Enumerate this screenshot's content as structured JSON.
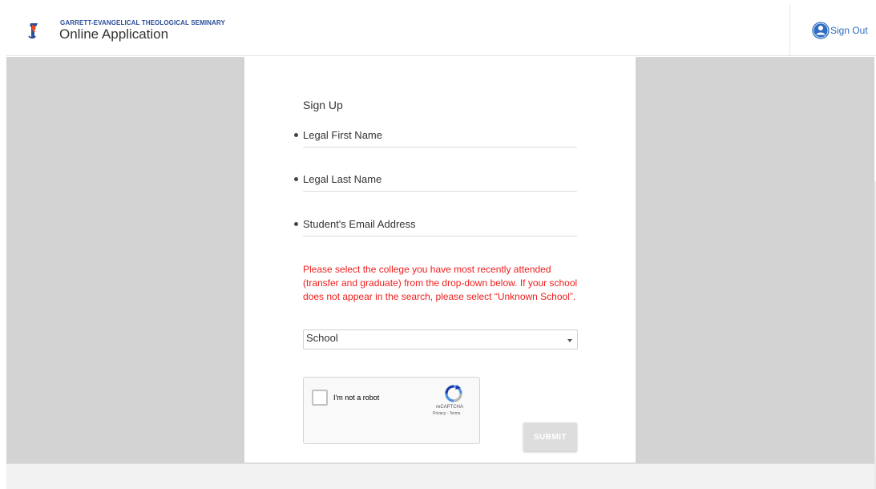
{
  "header": {
    "org_name": "GARRETT-EVANGELICAL THEOLOGICAL SEMINARY",
    "app_title": "Online Application",
    "sign_out_label": "Sign Out"
  },
  "form": {
    "title": "Sign Up",
    "first_name_placeholder": "Legal First Name",
    "last_name_placeholder": "Legal Last Name",
    "email_placeholder": "Student's Email Address",
    "school_notice": "Please select the college you have most recently attended (transfer and graduate) from the drop-down below. If your school does not appear in the search, please select “Unknown School”.",
    "school_select_value": "School",
    "captcha_label": "I'm not a robot",
    "captcha_brand": "reCAPTCHA",
    "captcha_links": "Privacy - Terms",
    "submit_label": "SUBMIT"
  },
  "icons": {
    "logo": "seminary-logo-icon",
    "sign_out": "user-circle-icon",
    "select_caret": "caret-down-icon",
    "captcha": "recaptcha-icon"
  },
  "colors": {
    "brand_blue": "#2b4f9a",
    "link_blue": "#2f6dc1",
    "notice_red": "#ef1d1d",
    "submit_disabled": "#dddddd",
    "page_gray": "#d3d3d3"
  }
}
